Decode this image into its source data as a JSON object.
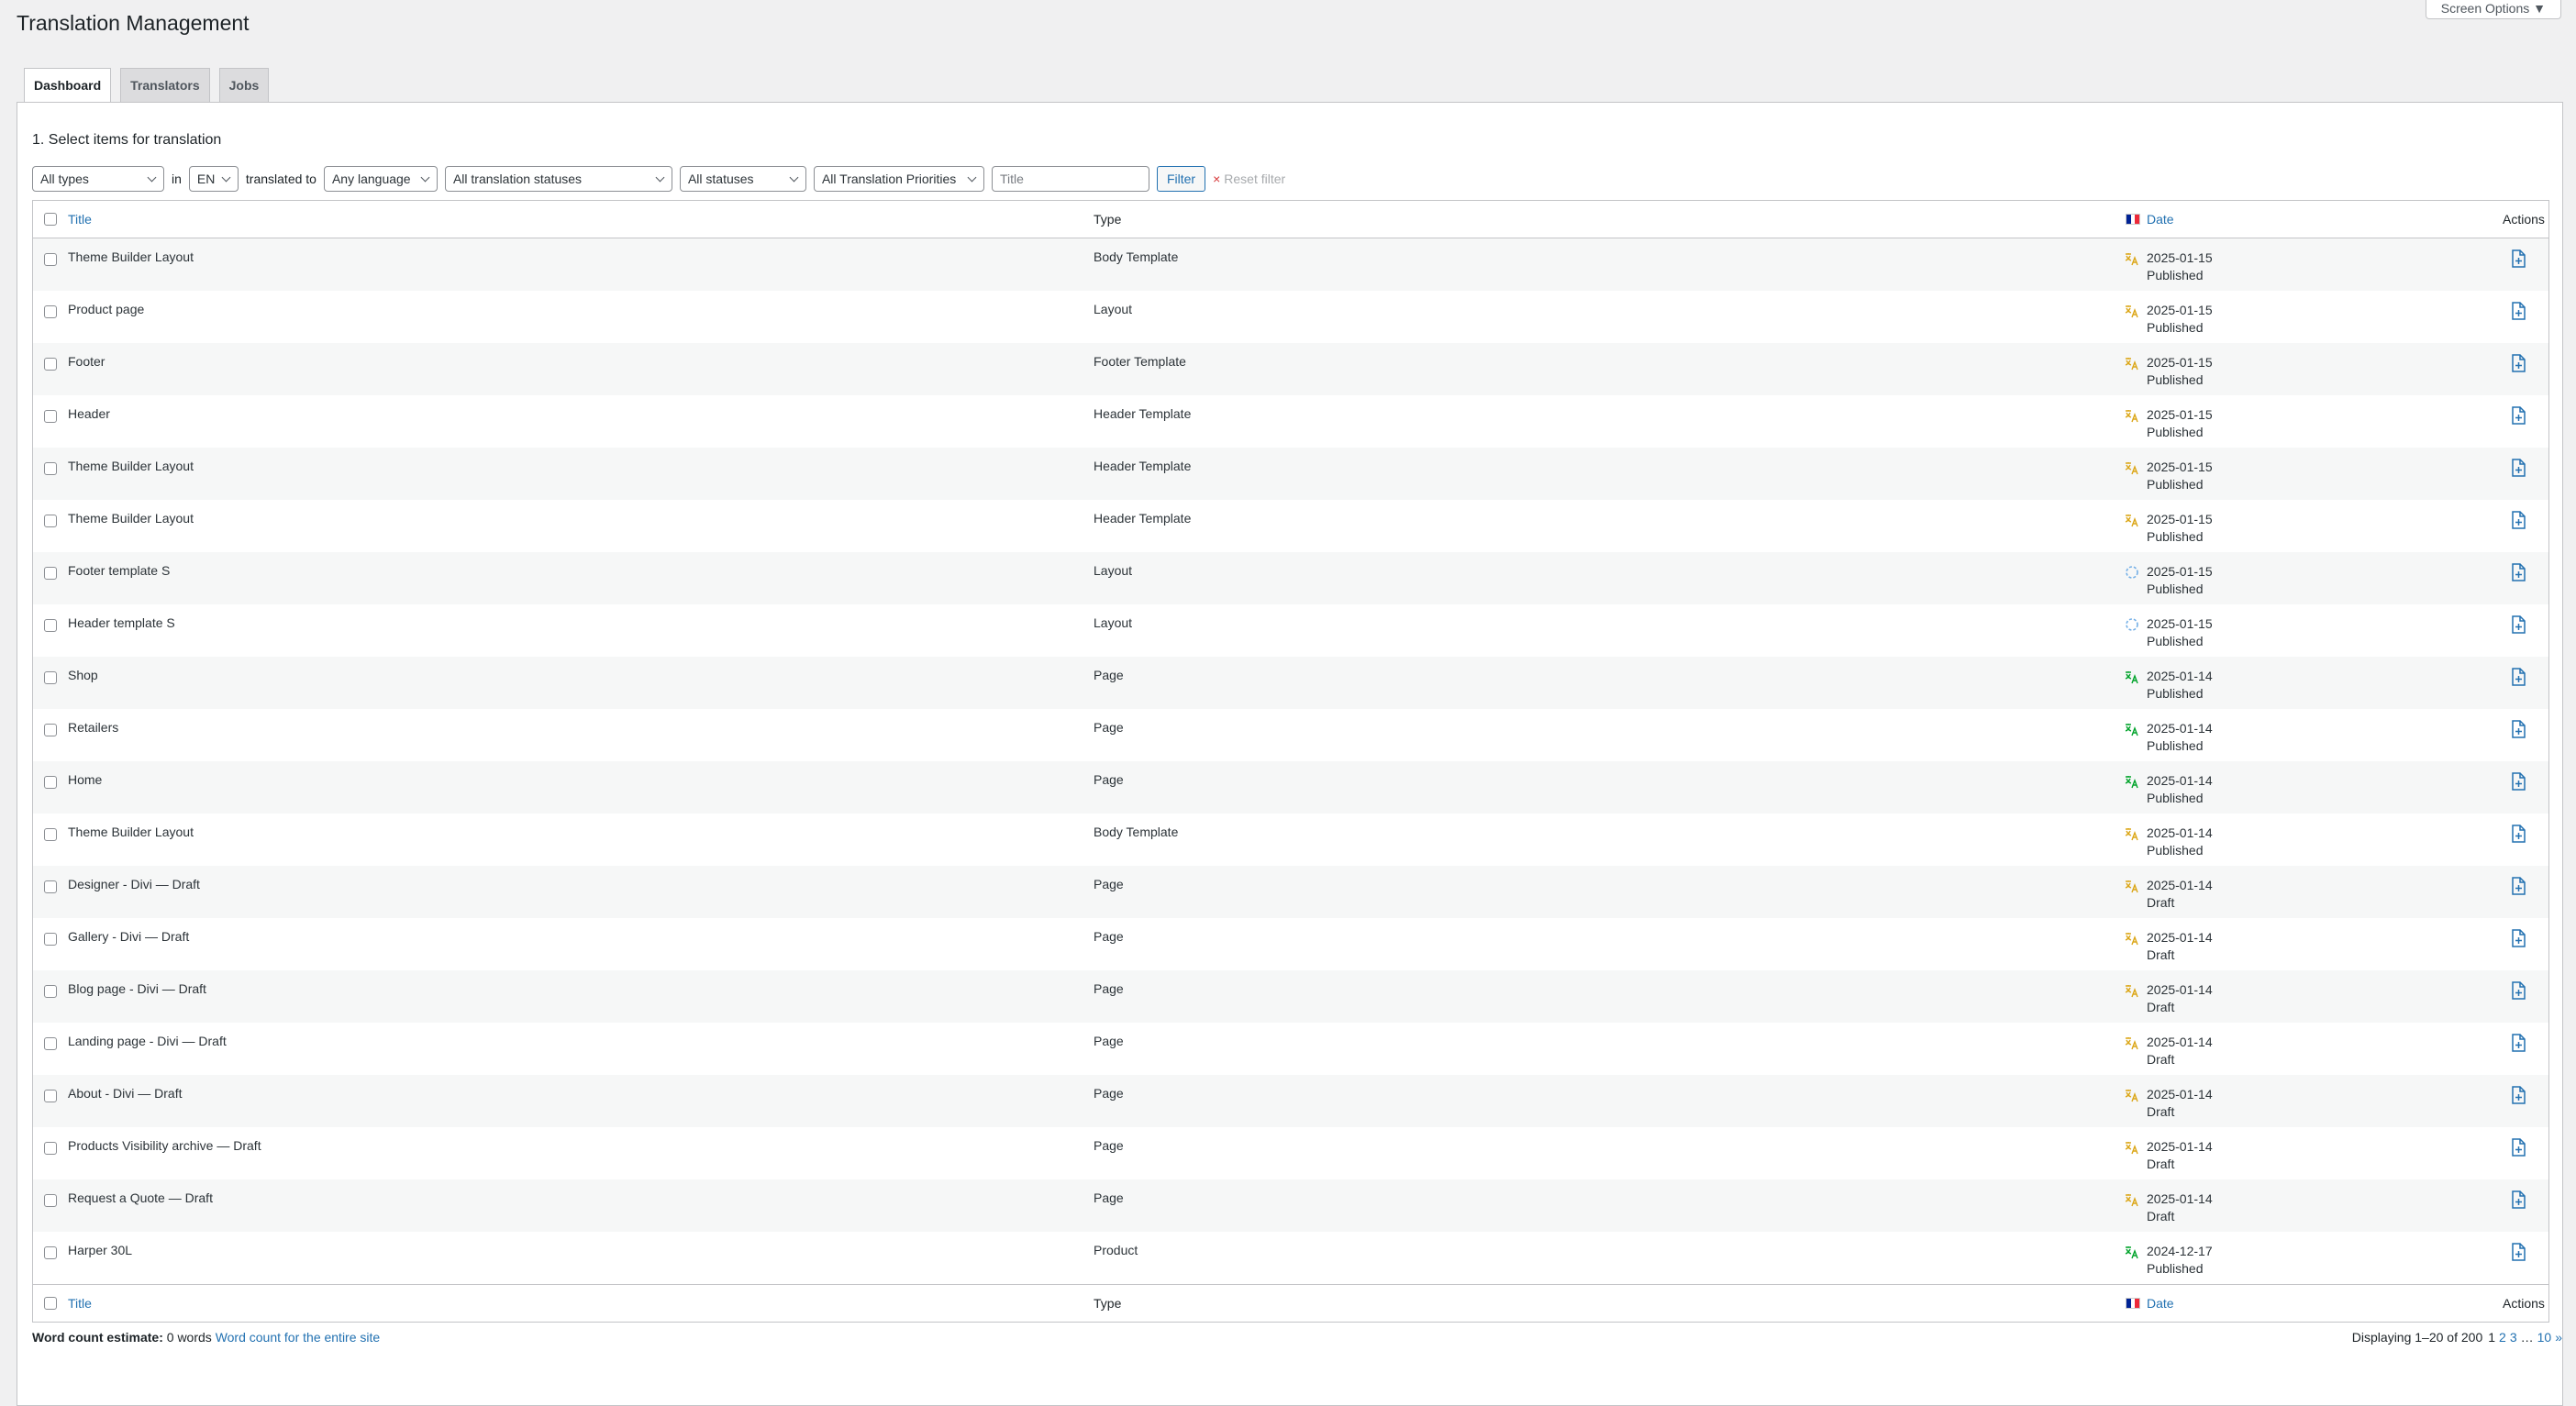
{
  "screen_options": "Screen Options ▼",
  "page_title": "Translation Management",
  "tabs": [
    {
      "label": "Dashboard",
      "active": true
    },
    {
      "label": "Translators",
      "active": false
    },
    {
      "label": "Jobs",
      "active": false
    }
  ],
  "section_title": "1. Select items for translation",
  "filters": {
    "types": "All types",
    "in_label": "in",
    "language": "EN",
    "translated_to_label": "translated to",
    "target_language": "Any language",
    "translation_status": "All translation statuses",
    "status": "All statuses",
    "priority": "All Translation Priorities",
    "title_placeholder": "Title",
    "filter_button": "Filter",
    "reset_icon": "×",
    "reset_label": "Reset filter"
  },
  "columns": {
    "title": "Title",
    "type": "Type",
    "date": "Date",
    "actions": "Actions"
  },
  "colors": {
    "accent": "#2271b1",
    "needs_translation": "#dba617",
    "in_progress": "#72aee6",
    "translated": "#00a32a"
  },
  "rows": [
    {
      "title": "Theme Builder Layout",
      "type": "Body Template",
      "date": "2025-01-15",
      "status": "Published",
      "icon": "needs-translation-icon"
    },
    {
      "title": "Product page",
      "type": "Layout",
      "date": "2025-01-15",
      "status": "Published",
      "icon": "needs-translation-icon"
    },
    {
      "title": "Footer",
      "type": "Footer Template",
      "date": "2025-01-15",
      "status": "Published",
      "icon": "needs-translation-icon"
    },
    {
      "title": "Header",
      "type": "Header Template",
      "date": "2025-01-15",
      "status": "Published",
      "icon": "needs-translation-icon"
    },
    {
      "title": "Theme Builder Layout",
      "type": "Header Template",
      "date": "2025-01-15",
      "status": "Published",
      "icon": "needs-translation-icon"
    },
    {
      "title": "Theme Builder Layout",
      "type": "Header Template",
      "date": "2025-01-15",
      "status": "Published",
      "icon": "needs-translation-icon"
    },
    {
      "title": "Footer template S",
      "type": "Layout",
      "date": "2025-01-15",
      "status": "Published",
      "icon": "in-progress-icon"
    },
    {
      "title": "Header template S",
      "type": "Layout",
      "date": "2025-01-15",
      "status": "Published",
      "icon": "in-progress-icon"
    },
    {
      "title": "Shop",
      "type": "Page",
      "date": "2025-01-14",
      "status": "Published",
      "icon": "translated-icon"
    },
    {
      "title": "Retailers",
      "type": "Page",
      "date": "2025-01-14",
      "status": "Published",
      "icon": "translated-icon"
    },
    {
      "title": "Home",
      "type": "Page",
      "date": "2025-01-14",
      "status": "Published",
      "icon": "translated-icon"
    },
    {
      "title": "Theme Builder Layout",
      "type": "Body Template",
      "date": "2025-01-14",
      "status": "Published",
      "icon": "needs-translation-icon"
    },
    {
      "title": "Designer - Divi — Draft",
      "type": "Page",
      "date": "2025-01-14",
      "status": "Draft",
      "icon": "needs-translation-icon"
    },
    {
      "title": "Gallery - Divi — Draft",
      "type": "Page",
      "date": "2025-01-14",
      "status": "Draft",
      "icon": "needs-translation-icon"
    },
    {
      "title": "Blog page - Divi — Draft",
      "type": "Page",
      "date": "2025-01-14",
      "status": "Draft",
      "icon": "needs-translation-icon"
    },
    {
      "title": "Landing page - Divi — Draft",
      "type": "Page",
      "date": "2025-01-14",
      "status": "Draft",
      "icon": "needs-translation-icon"
    },
    {
      "title": "About - Divi — Draft",
      "type": "Page",
      "date": "2025-01-14",
      "status": "Draft",
      "icon": "needs-translation-icon"
    },
    {
      "title": "Products Visibility archive — Draft",
      "type": "Page",
      "date": "2025-01-14",
      "status": "Draft",
      "icon": "needs-translation-icon"
    },
    {
      "title": "Request a Quote — Draft",
      "type": "Page",
      "date": "2025-01-14",
      "status": "Draft",
      "icon": "needs-translation-icon"
    },
    {
      "title": "Harper 30L",
      "type": "Product",
      "date": "2024-12-17",
      "status": "Published",
      "icon": "translated-icon"
    }
  ],
  "word_count": {
    "label": "Word count estimate:",
    "value": "0 words",
    "link": "Word count for the entire site"
  },
  "pagination": {
    "displaying": "Displaying 1–20 of 200",
    "pages": [
      "1",
      "2",
      "3",
      "…",
      "10",
      "»"
    ]
  }
}
